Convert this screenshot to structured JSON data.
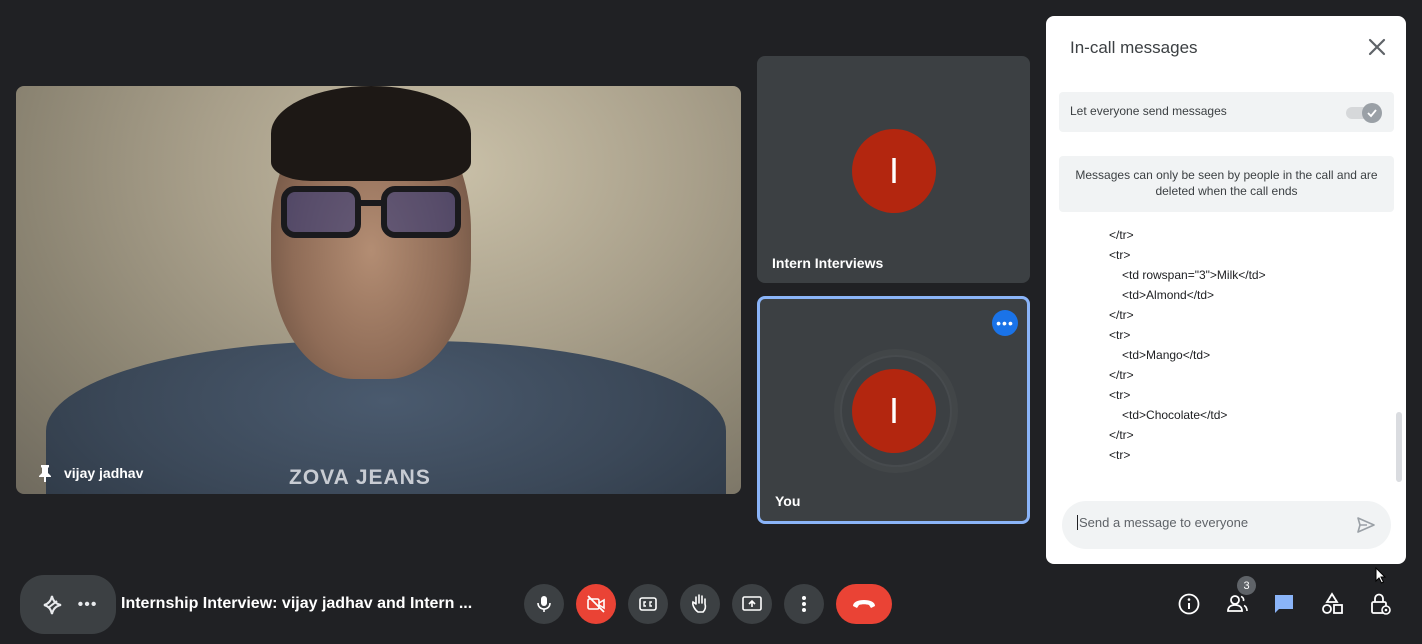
{
  "main_video": {
    "participant_name": "vijay jadhav",
    "shirt_text": "ZOVA JEANS"
  },
  "tiles": [
    {
      "name": "Intern Interviews",
      "avatar_letter": "I",
      "avatar_color": "#b3260f"
    },
    {
      "name": "You",
      "avatar_letter": "I",
      "avatar_color": "#b3260f",
      "more_options": "•••"
    }
  ],
  "chat": {
    "title": "In-call messages",
    "toggle_label": "Let everyone send messages",
    "toggle_on": true,
    "notice": "Messages can only be seen by people in the call and are deleted when the call ends",
    "message_lines": [
      "</tr>",
      "<tr>",
      "<td rowspan=\"3\">Milk</td>",
      "<td>Almond</td>",
      "</tr>",
      "<tr>",
      "<td>Mango</td>",
      "</tr>",
      "<tr>",
      "<td>Chocolate</td>",
      "</tr>",
      "<tr>"
    ],
    "compose_placeholder": "Send a message to everyone"
  },
  "bottom_bar": {
    "more_label": "•••",
    "meeting_title": "Internship Interview: vijay jadhav and Intern ...",
    "participants_count": "3",
    "controls": [
      "microphone-icon",
      "camera-off-icon",
      "captions-icon",
      "raise-hand-icon",
      "present-icon",
      "more-vert-icon",
      "end-call-icon"
    ],
    "right_icons": [
      "info-icon",
      "people-icon",
      "chat-icon",
      "activities-icon",
      "host-controls-icon"
    ]
  },
  "colors": {
    "background": "#202124",
    "tile": "#3c4043",
    "accent_blue": "#8ab4f8",
    "end_call_red": "#ea4335",
    "avatar_red": "#b3260f"
  }
}
